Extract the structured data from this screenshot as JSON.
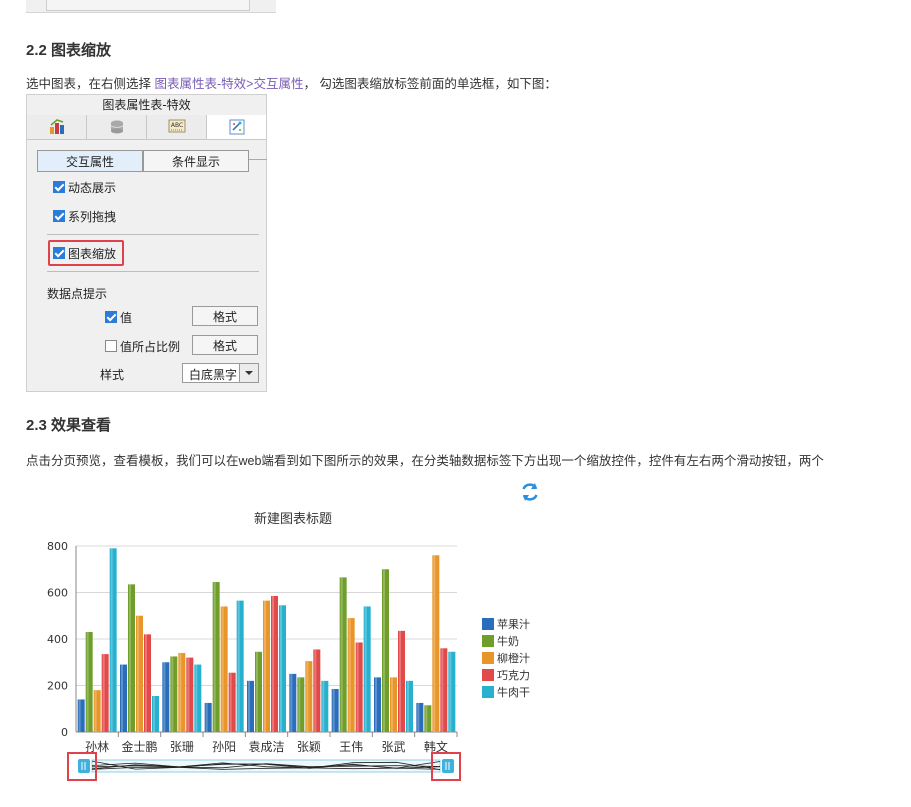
{
  "section_22": {
    "heading": "2.2 图表缩放",
    "para_before": "选中图表，在右侧选择 ",
    "para_link": "图表属性表-特效>交互属性",
    "para_after": "， 勾选图表缩放标签前面的单选框，如下图："
  },
  "panel": {
    "title": "图表属性表-特效",
    "tabs": [
      {
        "icon": "chart-style-icon"
      },
      {
        "icon": "database-icon"
      },
      {
        "icon": "text-label-icon",
        "text": "ABC"
      },
      {
        "icon": "effects-icon"
      }
    ],
    "subtabs": [
      "交互属性",
      "条件显示"
    ],
    "checks": [
      {
        "label": "动态展示",
        "checked": true
      },
      {
        "label": "系列拖拽",
        "checked": true
      },
      {
        "label": "图表缩放",
        "checked": true
      }
    ],
    "datapoint_heading": "数据点提示",
    "value_label": "值",
    "value_checked": true,
    "ratio_label": "值所占比例",
    "ratio_checked": false,
    "format_btn": "格式",
    "style_label": "样式",
    "style_value": "白底黑字"
  },
  "section_23": {
    "heading": "2.3 效果查看",
    "para": "点击分页预览，查看模板，我们可以在web端看到如下图所示的效果，在分类轴数据标签下方出现一个缩放控件，控件有左右两个滑动按钮，两个"
  },
  "refresh_icon": "refresh-icon",
  "chart_data": {
    "type": "bar",
    "title": "新建图表标题",
    "xlabel": "",
    "ylabel": "",
    "ylim": [
      0,
      800
    ],
    "yticks": [
      "0",
      "200",
      "400",
      "600",
      "800"
    ],
    "categories": [
      "孙林",
      "金士鹏",
      "张珊",
      "孙阳",
      "袁成洁",
      "张颖",
      "王伟",
      "张武",
      "韩文"
    ],
    "series": [
      {
        "name": "苹果汁",
        "color": "#2a6ebb",
        "values": [
          140,
          290,
          300,
          125,
          220,
          250,
          185,
          235,
          125
        ]
      },
      {
        "name": "牛奶",
        "color": "#6f9e2a",
        "values": [
          430,
          635,
          325,
          645,
          345,
          235,
          665,
          700,
          115
        ]
      },
      {
        "name": "柳橙汁",
        "color": "#e8962a",
        "values": [
          180,
          500,
          340,
          540,
          565,
          305,
          490,
          235,
          760
        ]
      },
      {
        "name": "巧克力",
        "color": "#e24a4a",
        "values": [
          335,
          420,
          320,
          255,
          585,
          355,
          385,
          435,
          360
        ]
      },
      {
        "name": "牛肉干",
        "color": "#27b1cf",
        "values": [
          790,
          155,
          290,
          565,
          545,
          220,
          540,
          220,
          345
        ]
      }
    ],
    "legend_position": "right",
    "grid": true
  }
}
